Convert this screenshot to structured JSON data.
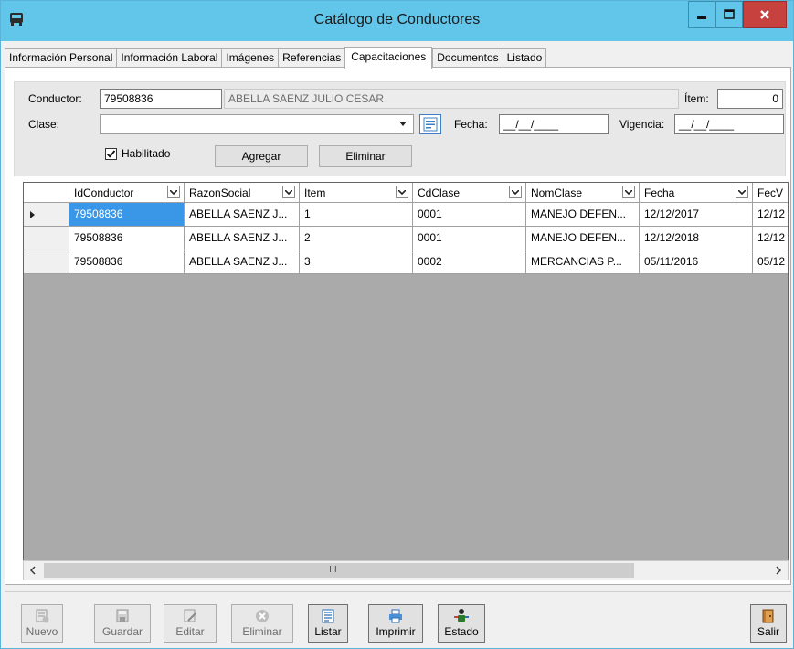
{
  "window": {
    "title": "Catálogo de Conductores",
    "accent": "#62c5ea",
    "close_color": "#c7413f"
  },
  "tabs": [
    {
      "label": "Información Personal",
      "active": false
    },
    {
      "label": "Información Laboral",
      "active": false
    },
    {
      "label": "Imágenes",
      "active": false
    },
    {
      "label": "Referencias",
      "active": false
    },
    {
      "label": "Capacitaciones",
      "active": true
    },
    {
      "label": "Documentos",
      "active": false
    },
    {
      "label": "Listado",
      "active": false
    }
  ],
  "form": {
    "conductor_label": "Conductor:",
    "conductor_value": "79508836",
    "conductor_name": "ABELLA SAENZ JULIO CESAR",
    "item_label": "Ítem:",
    "item_value": "0",
    "clase_label": "Clase:",
    "clase_value": "",
    "fecha_label": "Fecha:",
    "fecha_value": "__/__/____",
    "vigencia_label": "Vigencia:",
    "vigencia_value": "__/__/____",
    "habilitado_label": "Habilitado",
    "habilitado_checked": true,
    "agregar_label": "Agregar",
    "eliminar_label": "Eliminar"
  },
  "grid": {
    "columns": [
      "IdConductor",
      "RazonSocial",
      "Item",
      "CdClase",
      "NomClase",
      "Fecha",
      "FecV"
    ],
    "rows": [
      [
        "79508836",
        "ABELLA SAENZ J...",
        "1",
        "0001",
        "MANEJO DEFEN...",
        "12/12/2017",
        "12/12"
      ],
      [
        "79508836",
        "ABELLA SAENZ J...",
        "2",
        "0001",
        "MANEJO DEFEN...",
        "12/12/2018",
        "12/12"
      ],
      [
        "79508836",
        "ABELLA SAENZ J...",
        "3",
        "0002",
        "MERCANCIAS P...",
        "05/11/2016",
        "05/12"
      ]
    ],
    "selected_row": 0,
    "selection_color": "#3a97e8",
    "scroll_thumb_glyph": "III"
  },
  "toolbar": [
    {
      "label": "Nuevo",
      "icon": "new-document-icon",
      "enabled": false
    },
    {
      "label": "Guardar",
      "icon": "save-icon",
      "enabled": false
    },
    {
      "label": "Editar",
      "icon": "edit-icon",
      "enabled": false
    },
    {
      "label": "Eliminar",
      "icon": "delete-icon",
      "enabled": false
    },
    {
      "label": "Listar",
      "icon": "list-icon",
      "enabled": true
    },
    {
      "label": "Imprimir",
      "icon": "printer-icon",
      "enabled": true
    },
    {
      "label": "Estado",
      "icon": "status-person-icon",
      "enabled": true
    },
    {
      "label": "Salir",
      "icon": "exit-door-icon",
      "enabled": true
    }
  ]
}
